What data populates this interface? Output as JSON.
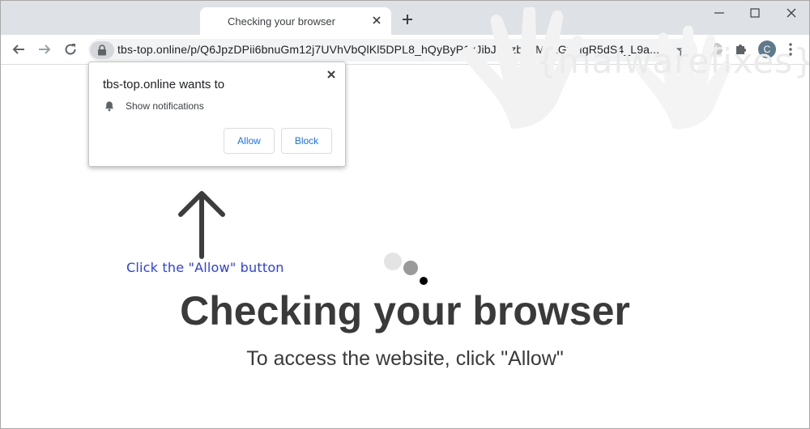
{
  "browser": {
    "tab_title": "Checking your browser",
    "url": "tbs-top.online/p/Q6JpzDPii6bnuGm12j7UVhVbQlKl5DPL8_hQyByP1xJibJUszb22M3LGyMgR5dS4_L9a...",
    "profile_initial": "C",
    "accent_color": "#1a73e8"
  },
  "permission_popup": {
    "title": "tbs-top.online wants to",
    "permission_label": "Show notifications",
    "allow_label": "Allow",
    "block_label": "Block"
  },
  "page": {
    "hint_text": "Click the \"Allow\" button",
    "headline": "Checking your browser",
    "subtext": "To access the website, click \"Allow\"",
    "hint_color": "#2b3fe0",
    "watermark_text": "{malwarefixes}"
  },
  "icons": {
    "back": "arrow-left-icon",
    "forward": "arrow-right-icon",
    "reload": "reload-icon",
    "lock": "lock-icon",
    "star": "star-icon",
    "extension_1": "lightning-icon",
    "extension_2": "puzzle-icon",
    "menu": "kebab-menu-icon",
    "notification": "bell-icon",
    "close": "close-icon"
  }
}
